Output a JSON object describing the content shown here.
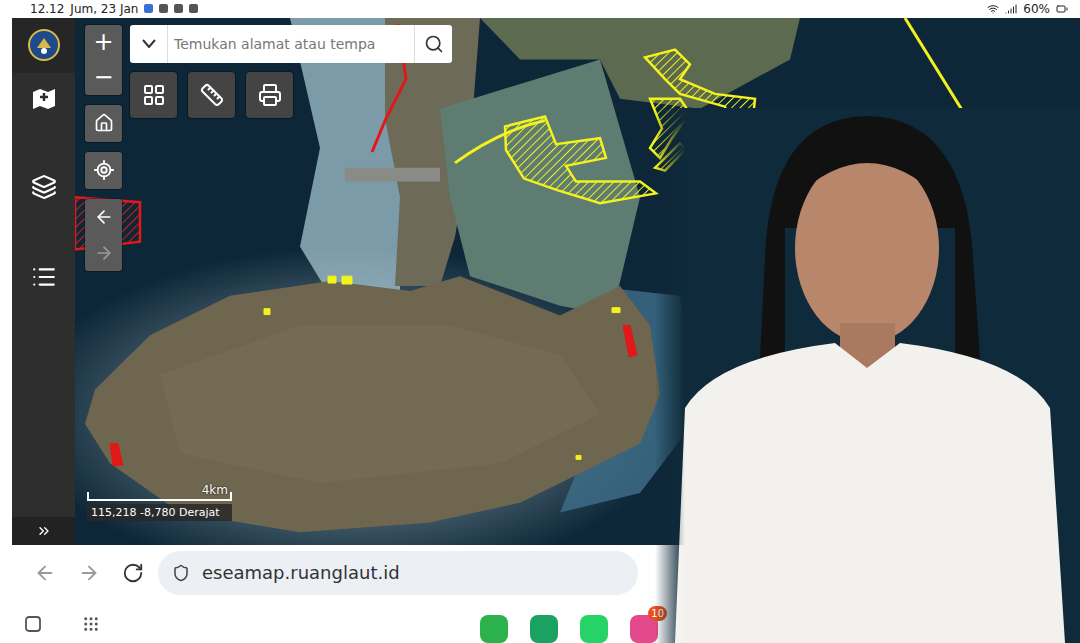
{
  "status_bar": {
    "time": "12.12",
    "date": "Jum, 23 Jan",
    "battery": "60%"
  },
  "map": {
    "zoom": [
      "+",
      "−"
    ],
    "search": {
      "placeholder": "Temukan alamat atau tempa"
    },
    "scale": "4km",
    "coordinates": "115,218 -8,780 Derajat",
    "zones": [
      {
        "kind": "hatched",
        "color": "#f2f21c"
      },
      {
        "kind": "hatched",
        "color": "#f2f21c"
      },
      {
        "kind": "line",
        "color": "#f2f21c"
      },
      {
        "kind": "line",
        "color": "#f2f21c"
      },
      {
        "kind": "line",
        "color": "#e01818"
      },
      {
        "kind": "hatched",
        "color": "#e01818"
      },
      {
        "kind": "hatched",
        "color": "#e01818"
      },
      {
        "kind": "solid",
        "color": "#e01818"
      },
      {
        "kind": "solid",
        "color": "#e01818"
      },
      {
        "kind": "solid",
        "color": "#f2f21c"
      }
    ]
  },
  "browser": {
    "url": "eseamap.ruanglaut.id",
    "back_enabled": false,
    "forward_enabled": false
  },
  "nav_bar": {
    "badge": "10"
  }
}
